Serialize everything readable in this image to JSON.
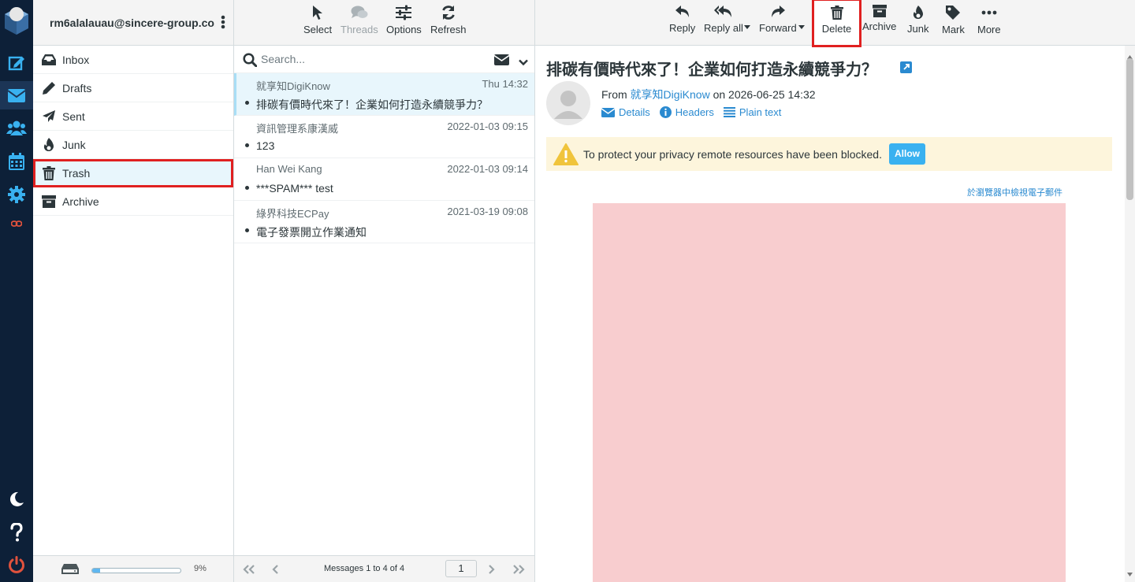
{
  "account": {
    "email": "rm6alalauau@sincere-group.co..."
  },
  "rail": {
    "items": [
      "compose-icon",
      "mail-icon",
      "contacts-icon",
      "calendar-icon",
      "settings-icon",
      "plugin-icon"
    ],
    "bottom": [
      "dark-mode-icon",
      "help-icon",
      "logout-icon"
    ]
  },
  "folders": [
    {
      "label": "Inbox",
      "icon": "inbox-icon"
    },
    {
      "label": "Drafts",
      "icon": "pencil-icon"
    },
    {
      "label": "Sent",
      "icon": "paper-plane-icon"
    },
    {
      "label": "Junk",
      "icon": "fire-icon"
    },
    {
      "label": "Trash",
      "icon": "trash-icon",
      "selected": true
    },
    {
      "label": "Archive",
      "icon": "archive-icon"
    }
  ],
  "quota": {
    "percent_label": "9%",
    "fraction": 0.09
  },
  "list_toolbar": {
    "select": "Select",
    "threads": "Threads",
    "options": "Options",
    "refresh": "Refresh"
  },
  "search": {
    "placeholder": "Search..."
  },
  "messages": [
    {
      "from": "就享知DigiKnow",
      "date": "Thu 14:32",
      "subject": "排碳有價時代來了！企業如何打造永續競爭力？",
      "selected": true
    },
    {
      "from": "資訊管理系康漢威",
      "date": "2022-01-03 09:15",
      "subject": "123"
    },
    {
      "from": "Han Wei Kang",
      "date": "2022-01-03 09:14",
      "subject": "***SPAM*** test"
    },
    {
      "from": "綠界科技ECPay",
      "date": "2021-03-19 09:08",
      "subject": "電子發票開立作業通知"
    }
  ],
  "pagination": {
    "count_text": "Messages 1 to 4 of 4",
    "page": "1"
  },
  "preview_toolbar": {
    "reply": "Reply",
    "reply_all": "Reply all",
    "forward": "Forward",
    "delete": "Delete",
    "archive": "Archive",
    "junk": "Junk",
    "mark": "Mark",
    "more": "More"
  },
  "email": {
    "subject": "排碳有價時代來了！企業如何打造永續競爭力？",
    "from_prefix": "From",
    "from_name": "就享知DigiKnow",
    "date_text": "on 2026-06-25 14:32",
    "links": {
      "details": "Details",
      "headers": "Headers",
      "plain_text": "Plain text"
    },
    "notice": "To protect your privacy remote resources have been blocked.",
    "allow": "Allow",
    "browser_link": "於瀏覽器中檢視電子郵件"
  },
  "colors": {
    "rail": "#0d2038",
    "accent": "#2a8ad0",
    "highlight": "#e02020",
    "selected_row": "#e8f6fc",
    "email_body": "#f8cdcf"
  }
}
